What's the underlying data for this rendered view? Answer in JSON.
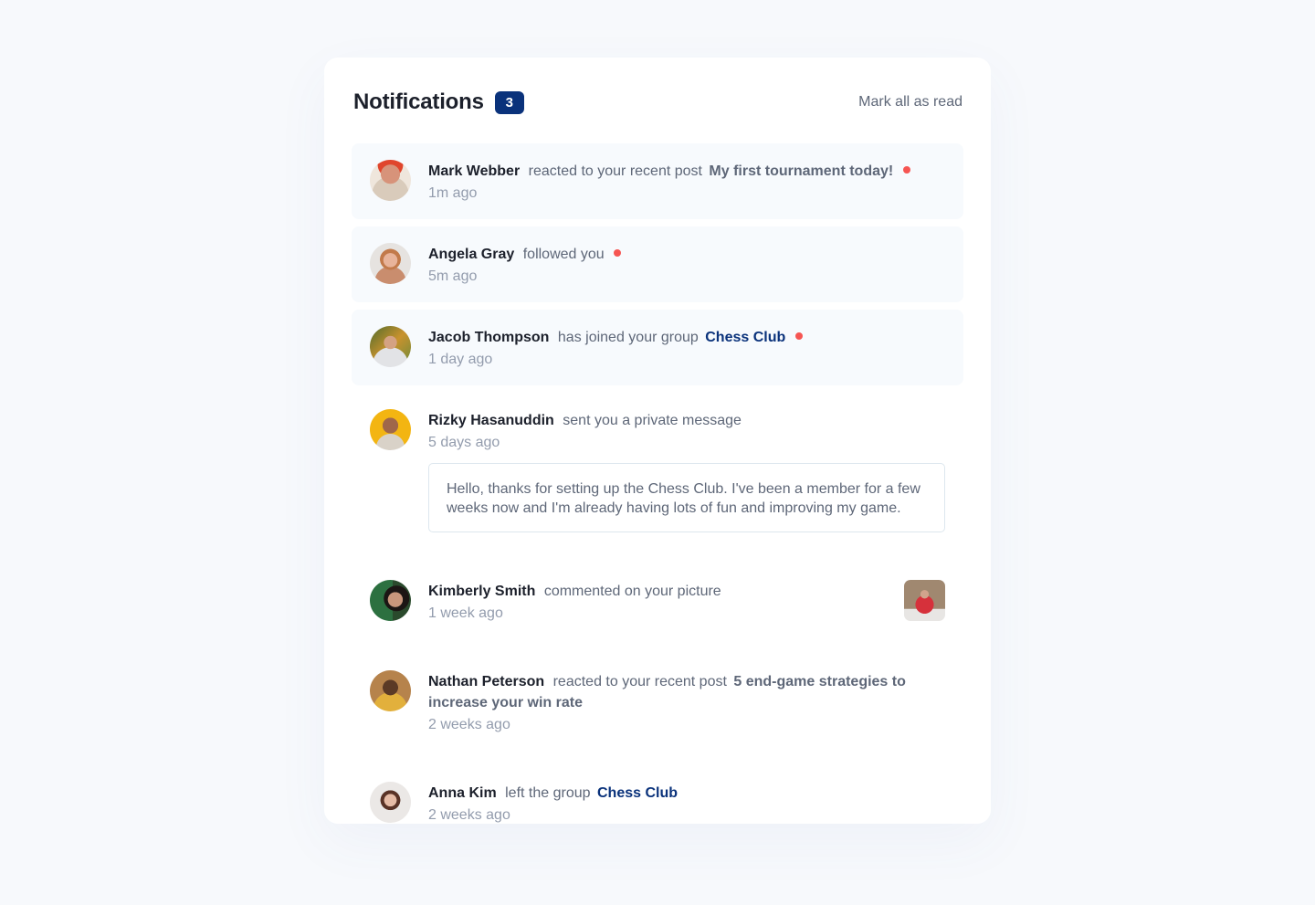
{
  "header": {
    "title": "Notifications",
    "unread_count": "3",
    "mark_all_label": "Mark all as read"
  },
  "colors": {
    "accent": "#0a327b",
    "unread_dot": "#f65552",
    "unread_bg": "#f7fafd",
    "page_bg": "#f7f9fc"
  },
  "notifications": [
    {
      "name": "Mark Webber",
      "action": "reacted to your recent post",
      "post": "My first tournament today!",
      "time": "1m ago",
      "unread": true
    },
    {
      "name": "Angela Gray",
      "action": "followed you",
      "time": "5m ago",
      "unread": true
    },
    {
      "name": "Jacob Thompson",
      "action": "has joined your group",
      "group": "Chess Club",
      "time": "1 day ago",
      "unread": true
    },
    {
      "name": "Rizky Hasanuddin",
      "action": "sent you a private message",
      "time": "5 days ago",
      "message": "Hello, thanks for setting up the Chess Club. I've been a member for a few weeks now and I'm already having lots of fun and improving my game.",
      "unread": false
    },
    {
      "name": "Kimberly Smith",
      "action": "commented on your picture",
      "time": "1 week ago",
      "has_picture": true,
      "unread": false
    },
    {
      "name": "Nathan Peterson",
      "action": "reacted to your recent post",
      "post": "5 end-game strategies to increase your win rate",
      "time": "2 weeks ago",
      "unread": false
    },
    {
      "name": "Anna Kim",
      "action": "left the group",
      "group": "Chess Club",
      "time": "2 weeks ago",
      "unread": false
    }
  ]
}
